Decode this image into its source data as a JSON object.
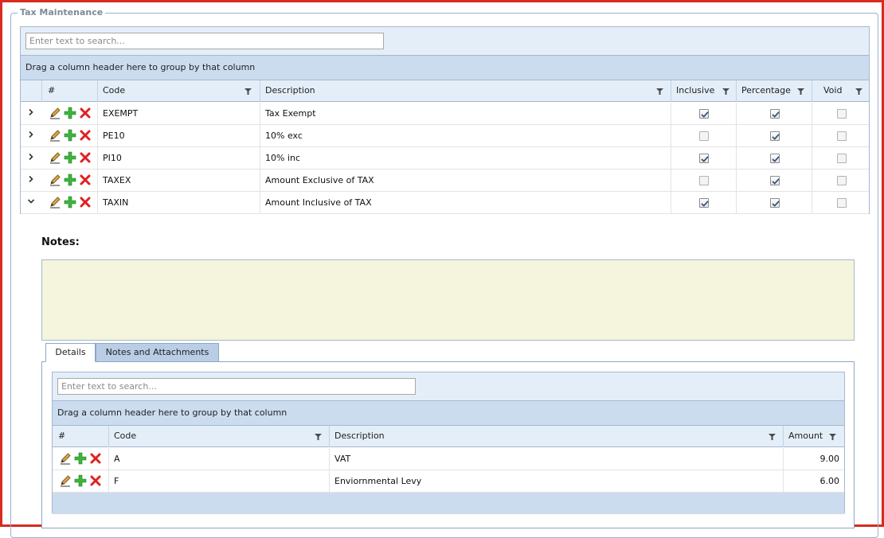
{
  "window": {
    "title": "Tax Maintenance"
  },
  "main_grid": {
    "search_placeholder": "Enter text to search...",
    "group_hint": "Drag a column header here to group by that column",
    "columns": {
      "num": "#",
      "code": "Code",
      "description": "Description",
      "inclusive": "Inclusive",
      "percentage": "Percentage",
      "void": "Void"
    },
    "rows": [
      {
        "code": "EXEMPT",
        "description": "Tax Exempt",
        "inclusive": true,
        "percentage": true,
        "void": false,
        "expanded": false
      },
      {
        "code": "PE10",
        "description": "10% exc",
        "inclusive": false,
        "percentage": true,
        "void": false,
        "expanded": false
      },
      {
        "code": "PI10",
        "description": "10% inc",
        "inclusive": true,
        "percentage": true,
        "void": false,
        "expanded": false
      },
      {
        "code": "TAXEX",
        "description": "Amount Exclusive of TAX",
        "inclusive": false,
        "percentage": true,
        "void": false,
        "expanded": false
      },
      {
        "code": "TAXIN",
        "description": "Amount Inclusive of TAX",
        "inclusive": true,
        "percentage": true,
        "void": false,
        "expanded": true
      }
    ]
  },
  "detail": {
    "notes_label": "Notes:",
    "notes_value": "",
    "tabs": [
      {
        "label": "Details",
        "active": true
      },
      {
        "label": "Notes and Attachments",
        "active": false
      }
    ],
    "grid": {
      "search_placeholder": "Enter text to search...",
      "group_hint": "Drag a column header here to group by that column",
      "columns": {
        "num": "#",
        "code": "Code",
        "description": "Description",
        "amount": "Amount"
      },
      "rows": [
        {
          "code": "A",
          "description": "VAT",
          "amount": "9.00"
        },
        {
          "code": "F",
          "description": "Enviornmental Levy",
          "amount": "6.00"
        }
      ]
    }
  },
  "icons": {
    "edit": "pencil-icon",
    "add": "plus-icon",
    "delete": "delete-x-icon",
    "filter": "filter-icon",
    "expand": "chevron-right-icon",
    "collapse": "chevron-down-icon"
  },
  "colors": {
    "border_accent": "#d62b1f",
    "header_bg": "#e4eef8",
    "group_bg": "#ccdcef",
    "notes_bg": "#f4f5dc"
  }
}
